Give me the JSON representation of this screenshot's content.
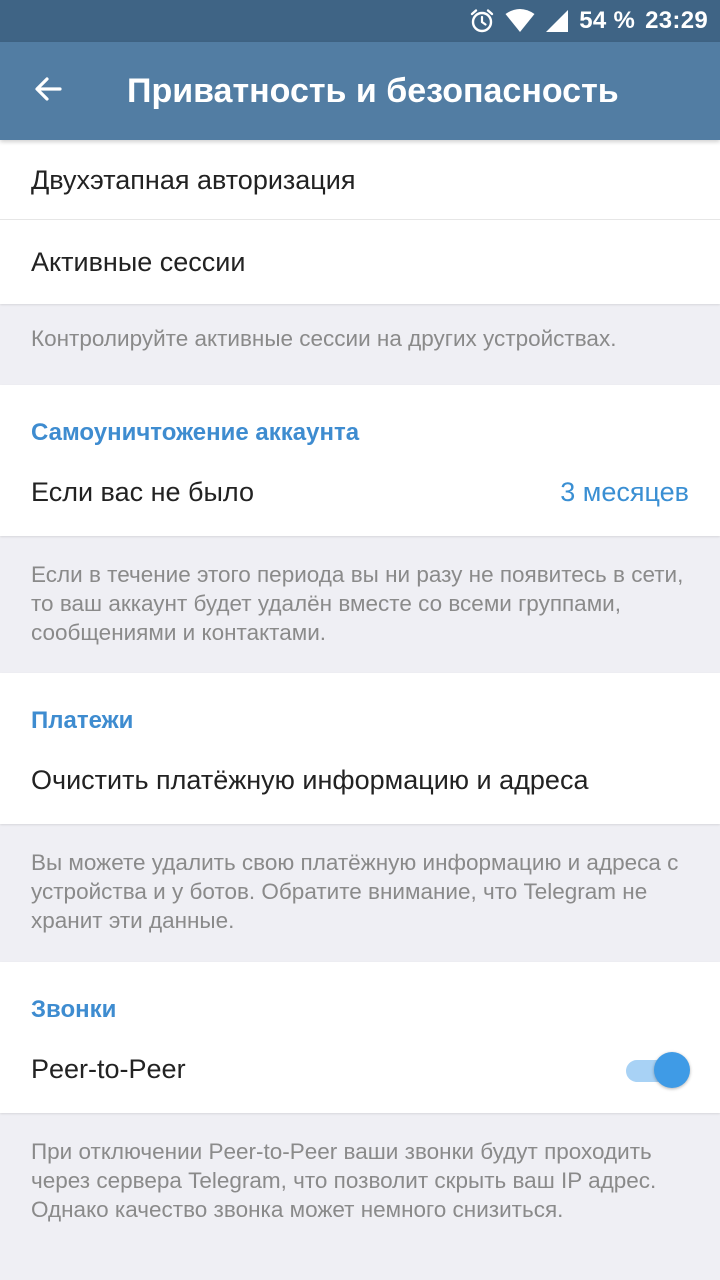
{
  "status_bar": {
    "battery": "54 %",
    "time": "23:29"
  },
  "app_bar": {
    "title": "Приватность и безопасность"
  },
  "security": {
    "two_step": "Двухэтапная авторизация",
    "sessions": "Активные сессии",
    "sessions_info": "Контролируйте активные сессии на других устройствах."
  },
  "self_destruct": {
    "header": "Самоуничтожение аккаунта",
    "row_label": "Если вас не было",
    "row_value": "3 месяцев",
    "info": "Если в течение этого периода вы ни разу не появитесь в сети, то ваш аккаунт будет удалён вместе со всеми группами, сообщениями и контактами."
  },
  "payments": {
    "header": "Платежи",
    "clear_label": "Очистить платёжную информацию и адреса",
    "info": "Вы можете удалить свою платёжную информацию и адреса с устройства и у ботов. Обратите внимание, что Telegram не хранит эти данные."
  },
  "calls": {
    "header": "Звонки",
    "p2p_label": "Peer-to-Peer",
    "p2p_enabled": true,
    "info": "При отключении Peer-to-Peer ваши звонки будут проходить через сервера Telegram, что позволит скрыть ваш IP адрес. Однако качество звонка может немного снизиться."
  },
  "colors": {
    "app_bar": "#527da3",
    "status_bar": "#3f6485",
    "accent": "#3e8cd0",
    "background": "#efeff4"
  }
}
